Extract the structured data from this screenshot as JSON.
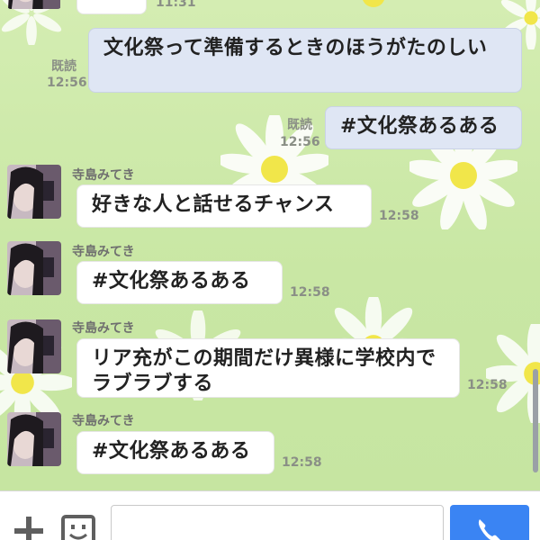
{
  "colors": {
    "background": "#cdeaa8",
    "incoming_bubble": "#ffffff",
    "outgoing_bubble": "#dfe6f4",
    "call_button": "#3a84f3"
  },
  "top_partial": {
    "time": "11:31"
  },
  "messages": [
    {
      "direction": "outgoing",
      "text": "文化祭って準備するときのほうがたのしい",
      "read": "既読",
      "time": "12:56"
    },
    {
      "direction": "outgoing",
      "text": "#文化祭あるある",
      "read": "既読",
      "time": "12:56"
    },
    {
      "direction": "incoming",
      "sender": "寺島みてき",
      "text": "好きな人と話せるチャンス",
      "time": "12:58"
    },
    {
      "direction": "incoming",
      "sender": "寺島みてき",
      "text": "#文化祭あるある",
      "time": "12:58"
    },
    {
      "direction": "incoming",
      "sender": "寺島みてき",
      "text": "リア充がこの期間だけ異様に学校内でラブラブする",
      "time": "12:58"
    },
    {
      "direction": "incoming",
      "sender": "寺島みてき",
      "text": "#文化祭あるある",
      "time": "12:58"
    }
  ],
  "input": {
    "value": "",
    "placeholder": ""
  },
  "icons": {
    "plus": "plus-icon",
    "sticker": "sticker-icon",
    "call": "phone-icon"
  }
}
